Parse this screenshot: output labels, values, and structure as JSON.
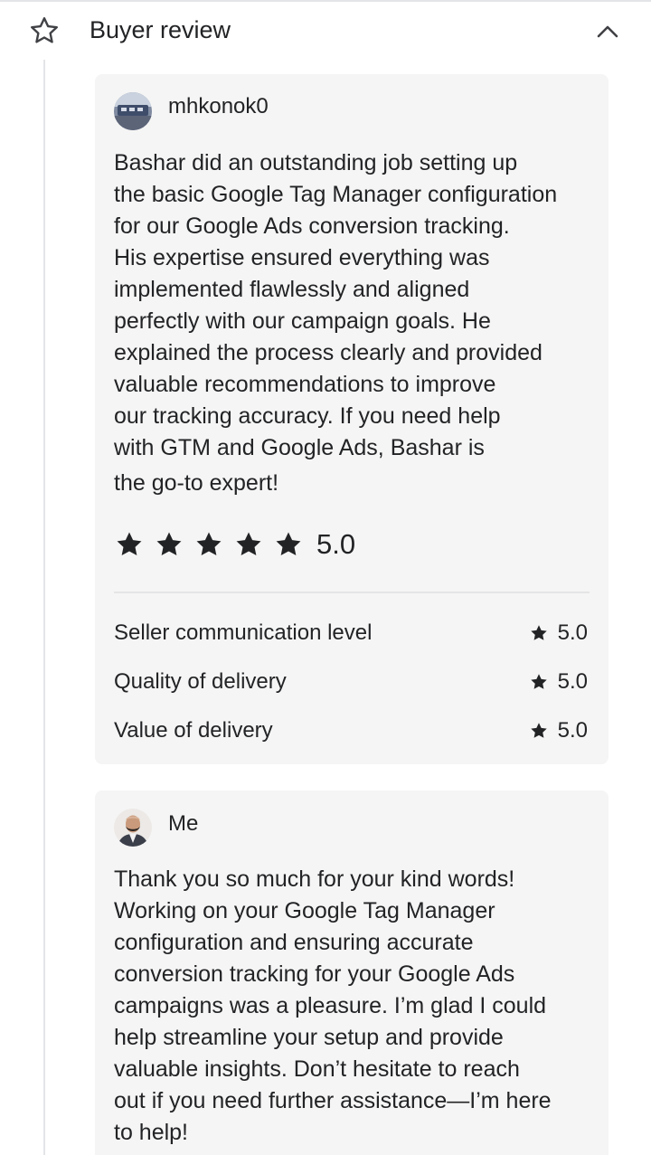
{
  "section": {
    "title": "Buyer review",
    "star_icon": "star-outline-icon",
    "collapse_icon": "chevron-up-icon"
  },
  "review": {
    "username": "mhkonok0",
    "text_lines": [
      "Bashar did an outstanding job setting up",
      "the basic Google Tag Manager configuration",
      "for our Google Ads conversion tracking.",
      "His expertise ensured everything was",
      "implemented flawlessly and aligned",
      "perfectly with our campaign goals. He",
      "explained the process clearly and provided",
      "valuable recommendations to improve",
      "our tracking accuracy. If you need help",
      "with GTM and Google Ads, Bashar is",
      "the go-to expert!"
    ],
    "overall_rating": "5.0",
    "star_count": 5,
    "breakdown": [
      {
        "label": "Seller communication level",
        "value": "5.0"
      },
      {
        "label": "Quality of delivery",
        "value": "5.0"
      },
      {
        "label": "Value of delivery",
        "value": "5.0"
      }
    ]
  },
  "reply": {
    "username": "Me",
    "text_lines": [
      "Thank you so much for your kind words!",
      "Working on your Google Tag Manager",
      "configuration and ensuring accurate",
      "conversion tracking for your Google Ads",
      "campaigns was a pleasure. I’m glad I could",
      "help streamline your setup and provide",
      "valuable insights. Don’t hesitate to reach",
      "out if you need further assistance—I’m here",
      "to help!"
    ]
  },
  "colors": {
    "text": "#222325",
    "card_bg": "#f5f5f5",
    "line": "#e4e5e7",
    "icon_outline": "#404145"
  }
}
